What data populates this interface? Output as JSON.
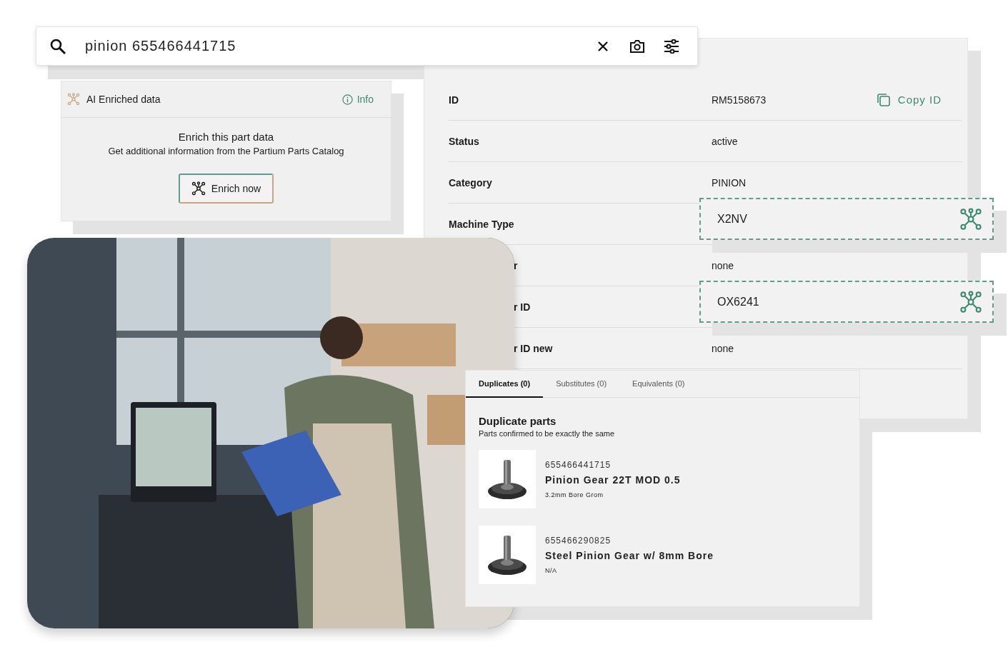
{
  "search": {
    "value": "pinion 655466441715"
  },
  "ai_card": {
    "title": "AI Enriched data",
    "info": "Info",
    "heading": "Enrich this part data",
    "description": "Get additional information from the Partium Parts Catalog",
    "button": "Enrich now"
  },
  "details": {
    "rows": [
      {
        "label": "ID",
        "value": "RM5158673",
        "kind": "plain",
        "cut": false,
        "action": "Copy ID"
      },
      {
        "label": "Status",
        "value": "active",
        "kind": "plain",
        "cut": false
      },
      {
        "label": "Category",
        "value": "PINION",
        "kind": "plain",
        "cut": false
      },
      {
        "label": "Machine Type",
        "value": "X2NV",
        "kind": "enriched",
        "cut": false
      },
      {
        "label": "r",
        "value": "none",
        "kind": "plain",
        "cut": true
      },
      {
        "label": "r ID",
        "value": "OX6241",
        "kind": "enriched",
        "cut": true
      },
      {
        "label": "r ID new",
        "value": "none",
        "kind": "plain",
        "cut": true
      }
    ]
  },
  "related": {
    "tabs": [
      {
        "label": "Duplicates (0)",
        "selected": true
      },
      {
        "label": "Substitutes (0)",
        "selected": false
      },
      {
        "label": "Equivalents (0)",
        "selected": false
      }
    ],
    "title": "Duplicate parts",
    "subtitle": "Parts confirmed to be exactly the same",
    "items": [
      {
        "number": "655466441715",
        "name": "Pinion Gear 22T MOD 0.5",
        "note": "3.2mm Bore Grom"
      },
      {
        "number": "655466290825",
        "name": "Steel Pinion Gear w/ 8mm Bore",
        "note": "N/A"
      }
    ]
  }
}
